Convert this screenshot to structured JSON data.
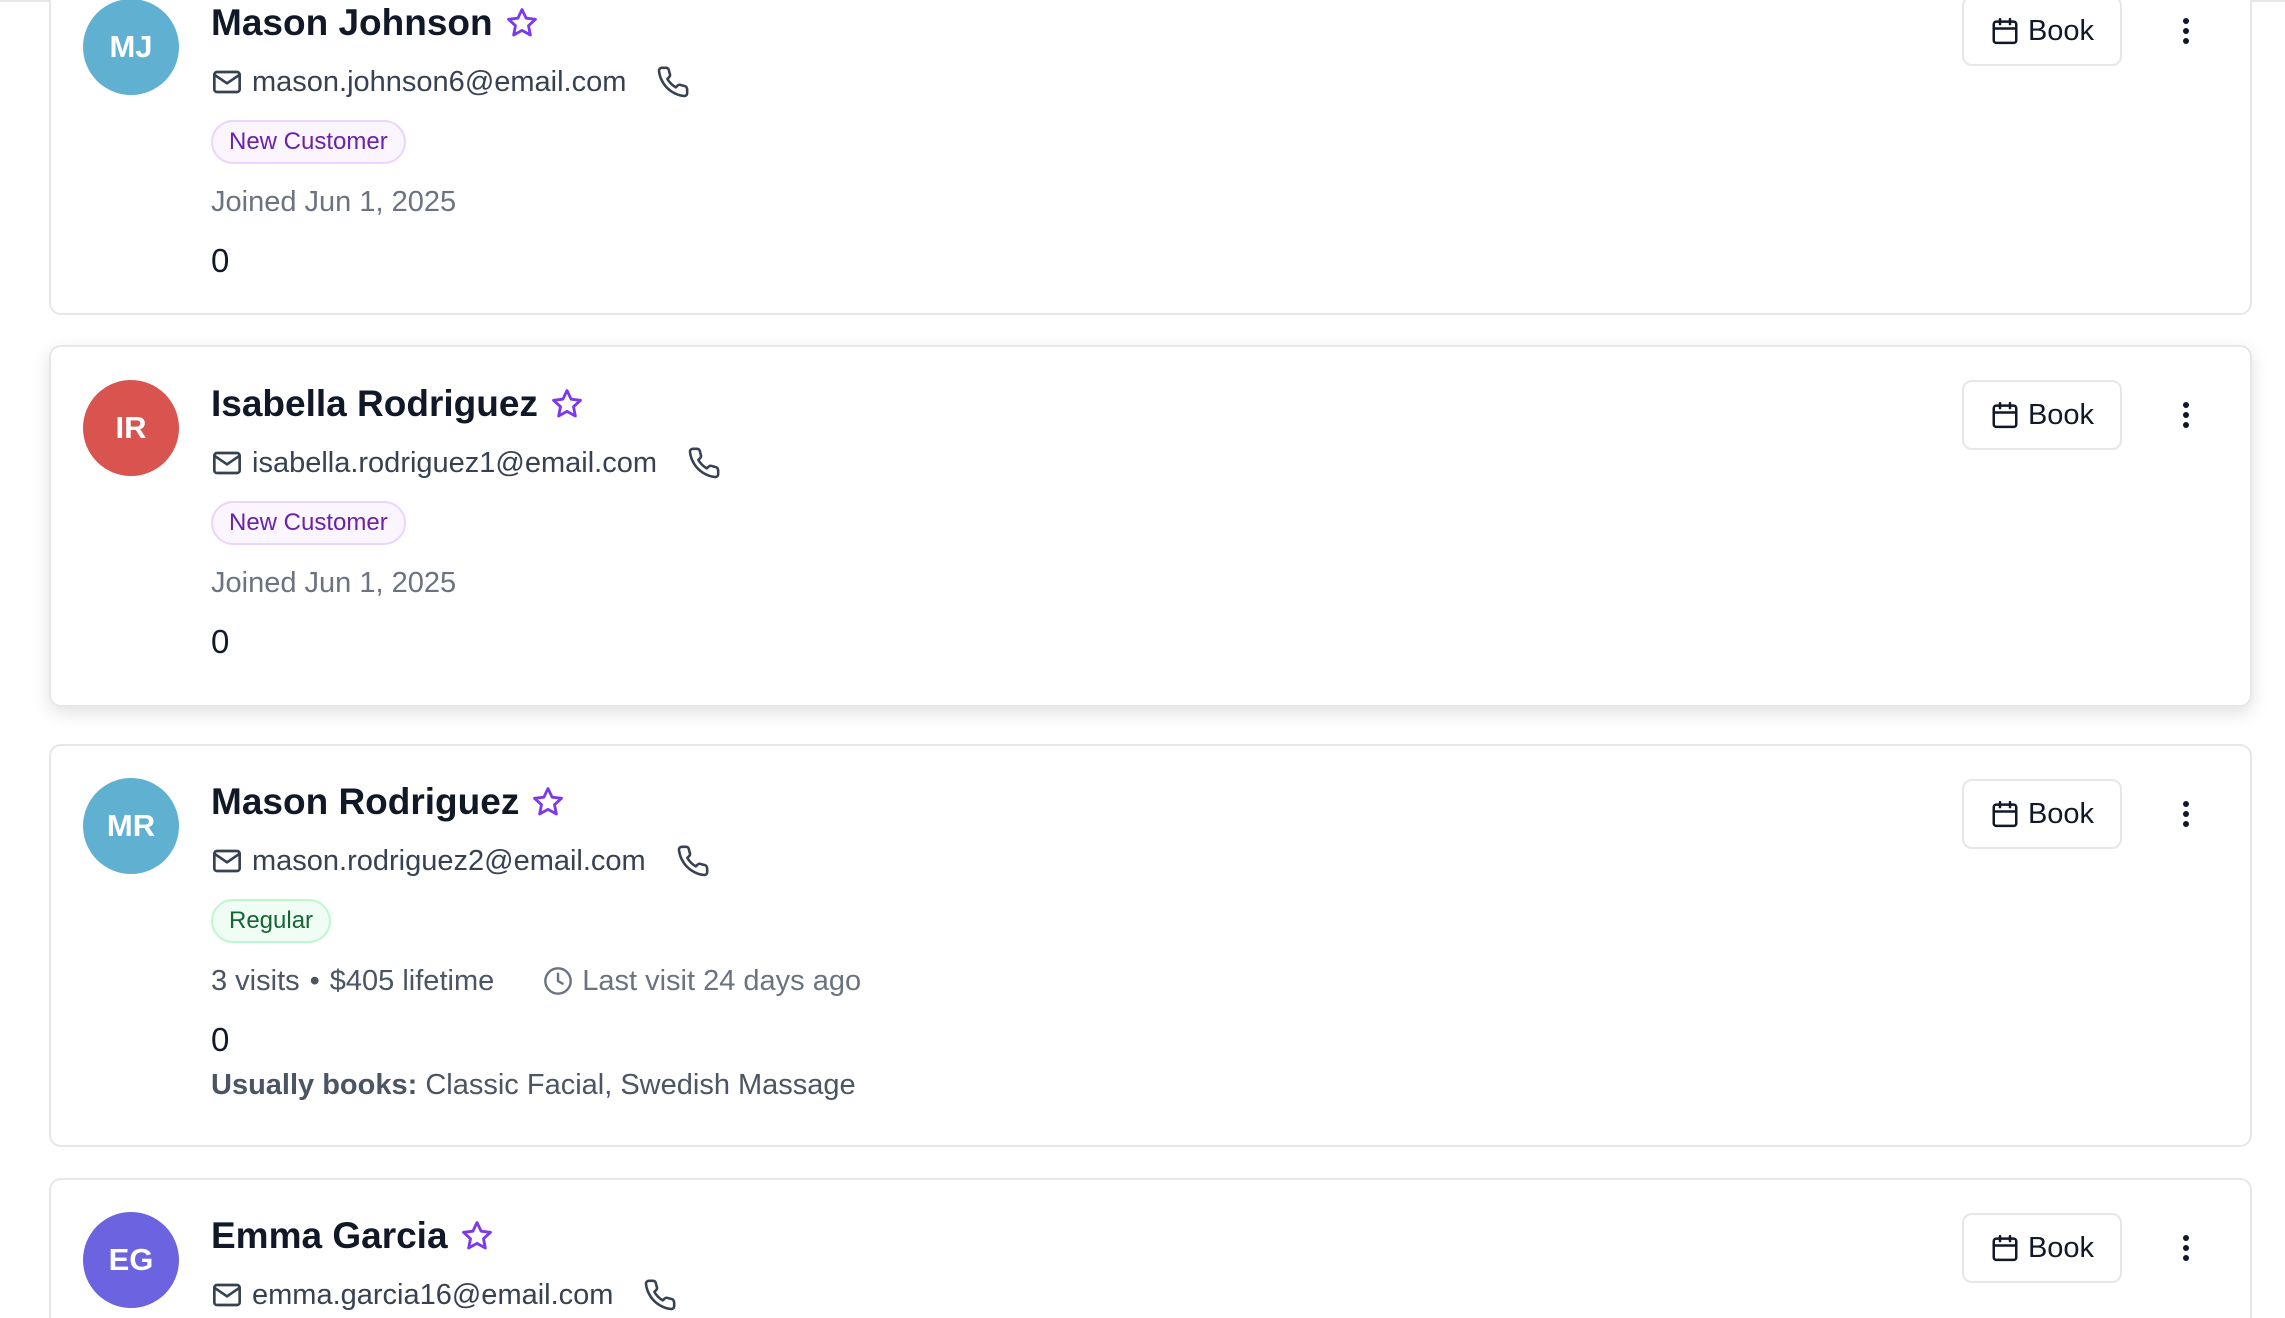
{
  "customers": [
    {
      "initials": "MJ",
      "avatar_color": "#5fb0d1",
      "name": "Mason Johnson",
      "email": "mason.johnson6@email.com",
      "badge": "New Customer",
      "badge_type": "new",
      "joined": "Joined Jun 1, 2025",
      "count": "0",
      "book_label": "Book"
    },
    {
      "initials": "IR",
      "avatar_color": "#d9534f",
      "name": "Isabella Rodriguez",
      "email": "isabella.rodriguez1@email.com",
      "badge": "New Customer",
      "badge_type": "new",
      "joined": "Joined Jun 1, 2025",
      "count": "0",
      "book_label": "Book"
    },
    {
      "initials": "MR",
      "avatar_color": "#5fb0d1",
      "name": "Mason Rodriguez",
      "email": "mason.rodriguez2@email.com",
      "badge": "Regular",
      "badge_type": "regular",
      "visits": "3 visits",
      "separator": "•",
      "lifetime": "$405 lifetime",
      "last_visit": "Last visit 24 days ago",
      "count": "0",
      "usually_label": "Usually books:",
      "usually_value": "Classic Facial, Swedish Massage",
      "book_label": "Book"
    },
    {
      "initials": "EG",
      "avatar_color": "#6b63e0",
      "name": "Emma Garcia",
      "email": "emma.garcia16@email.com",
      "book_label": "Book"
    }
  ],
  "colors": {
    "accent_purple": "#7c3aed",
    "icon_gray": "#374151"
  },
  "icons": {
    "star": "star-icon",
    "mail": "mail-icon",
    "phone": "phone-icon",
    "calendar": "calendar-icon",
    "clock": "clock-icon",
    "more": "more-vertical-icon"
  }
}
